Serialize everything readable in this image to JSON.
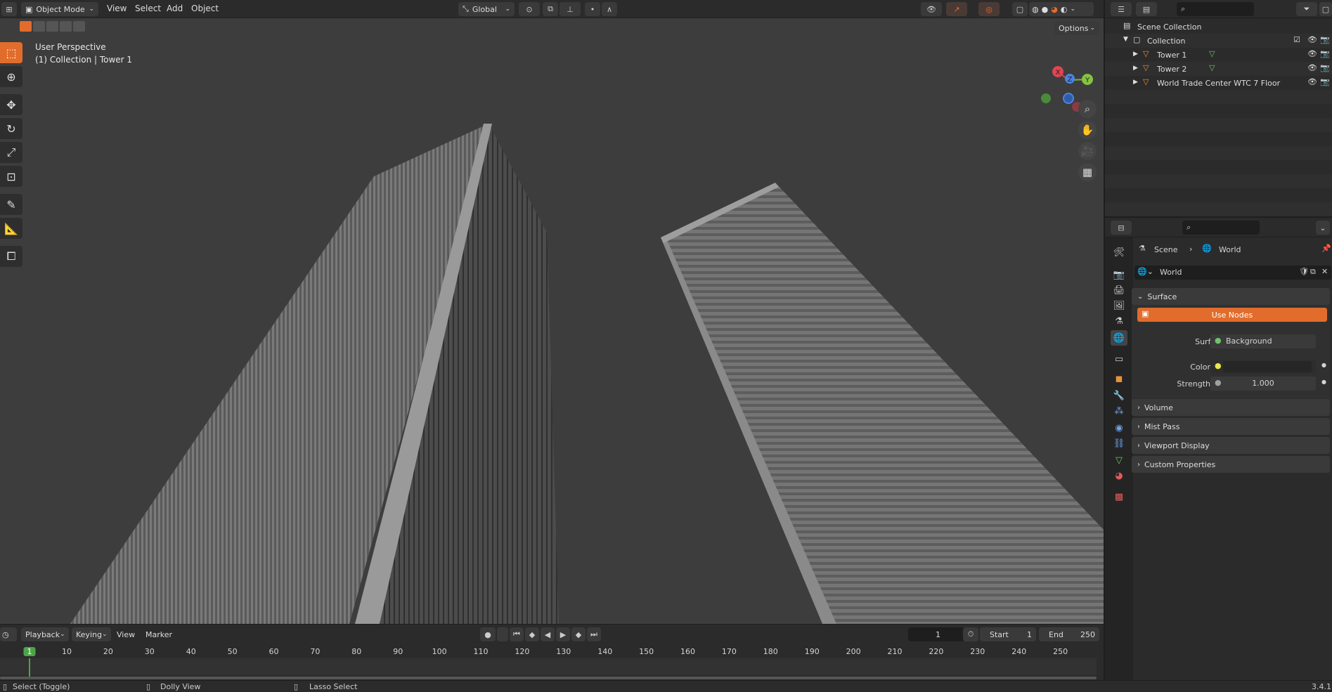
{
  "header": {
    "mode": "Object Mode",
    "menus": [
      "View",
      "Select",
      "Add",
      "Object"
    ],
    "transform_orientation": "Global",
    "options_label": "Options"
  },
  "viewport": {
    "perspective_label": "User Perspective",
    "collection_label": "(1) Collection | Tower 1",
    "gizmo_axes": {
      "x": "X",
      "y": "Y",
      "z": "Z"
    }
  },
  "outliner": {
    "items": [
      {
        "label": "Scene Collection",
        "icon": "scene-collection-icon"
      },
      {
        "label": "Collection",
        "icon": "collection-icon"
      },
      {
        "label": "Tower 1",
        "icon": "mesh-object-icon"
      },
      {
        "label": "Tower 2",
        "icon": "mesh-object-icon"
      },
      {
        "label": "World Trade Center WTC 7 Floor",
        "icon": "mesh-object-icon"
      }
    ]
  },
  "properties": {
    "breadcrumb_scene": "Scene",
    "breadcrumb_world": "World",
    "world_name": "World",
    "surface_panel": "Surface",
    "use_nodes_label": "Use Nodes",
    "surface_label": "Surface",
    "surface_value": "Background",
    "color_label": "Color",
    "strength_label": "Strength",
    "strength_value": "1.000",
    "panels": [
      "Volume",
      "Mist Pass",
      "Viewport Display",
      "Custom Properties"
    ],
    "accent_color": "#e26c2c"
  },
  "timeline": {
    "menus": [
      "Playback",
      "Keying",
      "View",
      "Marker"
    ],
    "current_frame": "1",
    "start_label": "Start",
    "start_value": "1",
    "end_label": "End",
    "end_value": "250",
    "ticks": [
      "1",
      "10",
      "20",
      "30",
      "40",
      "50",
      "60",
      "70",
      "80",
      "90",
      "100",
      "110",
      "120",
      "130",
      "140",
      "150",
      "160",
      "170",
      "180",
      "190",
      "200",
      "210",
      "220",
      "230",
      "240",
      "250"
    ]
  },
  "statusbar": {
    "select": "Select (Toggle)",
    "dolly": "Dolly View",
    "lasso": "Lasso Select",
    "version": "3.4.1"
  }
}
